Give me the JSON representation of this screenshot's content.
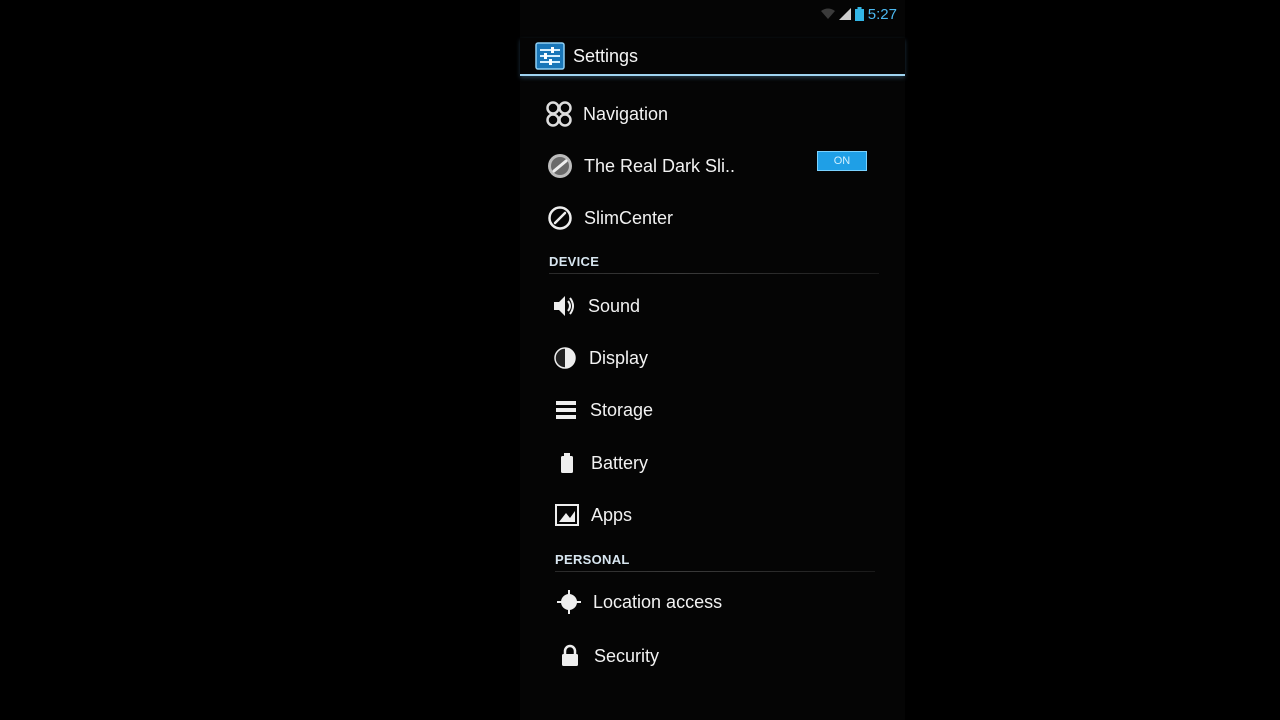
{
  "status_bar": {
    "time": "5:27"
  },
  "action_bar": {
    "title": "Settings",
    "icon": "settings-app-icon"
  },
  "items_top": [
    {
      "label": "Navigation",
      "icon": "navigation-icon"
    },
    {
      "label": "The Real Dark Sli..",
      "icon": "slim-logo-icon",
      "toggle": "ON"
    },
    {
      "label": "SlimCenter",
      "icon": "slimcenter-icon"
    }
  ],
  "sections": {
    "device": "DEVICE",
    "personal": "PERSONAL"
  },
  "device_items": [
    {
      "label": "Sound",
      "icon": "speaker-icon"
    },
    {
      "label": "Display",
      "icon": "display-icon"
    },
    {
      "label": "Storage",
      "icon": "storage-icon"
    },
    {
      "label": "Battery",
      "icon": "battery-icon"
    },
    {
      "label": "Apps",
      "icon": "apps-icon"
    }
  ],
  "personal_items": [
    {
      "label": "Location access",
      "icon": "location-icon"
    },
    {
      "label": "Security",
      "icon": "lock-icon"
    }
  ],
  "colors": {
    "accent": "#33b5e5",
    "toggle_on": "#1f9fe6",
    "background": "#000000"
  }
}
